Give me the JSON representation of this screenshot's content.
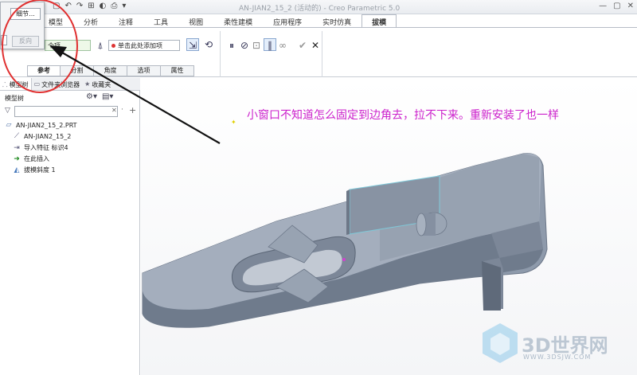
{
  "window": {
    "title": "AN-JIAN2_15_2 (活动的) - Creo Parametric 5.0",
    "quick_access": [
      "▢",
      "↶",
      "↷",
      "⊞",
      "◐",
      "⎙",
      "▾"
    ],
    "controls": [
      "—",
      "▢",
      "✕"
    ]
  },
  "ribbon": {
    "tabs": [
      "模型",
      "分析",
      "注释",
      "工具",
      "视图",
      "柔性建模",
      "应用程序",
      "实时仿真",
      "拔模"
    ],
    "active_tab": "拔模",
    "surface_field": "个项",
    "pivot_field_placeholder": "单击此处添加项",
    "subtabs": [
      "参考",
      "分割",
      "角度",
      "选项",
      "属性"
    ],
    "active_subtab": "参考",
    "control_icons": [
      "pause-icon",
      "stop-icon",
      "preview-icon",
      "verify-icon",
      "glasses-icon",
      "ok-icon",
      "cancel-icon"
    ]
  },
  "popup": {
    "detail_button": "细节...",
    "flip_button": "反向"
  },
  "panel": {
    "tabs": [
      "模型树",
      "文件夹浏览器",
      "收藏夹"
    ],
    "header": "模型树",
    "tree": [
      {
        "icon": "part-icon",
        "label": "AN-JIAN2_15_2.PRT",
        "indent": 0
      },
      {
        "icon": "feature-icon",
        "label": "AN-JIAN2_15_2",
        "indent": 1
      },
      {
        "icon": "import-icon",
        "label": "导入特征 标识4",
        "indent": 1
      },
      {
        "icon": "insert-here-icon",
        "label": "在此插入",
        "indent": 1
      },
      {
        "icon": "draft-icon",
        "label": "拔模斜度 1",
        "indent": 1
      }
    ]
  },
  "graphics": {
    "annotation": "小窗口不知道怎么固定到边角去，拉不下来。重新安装了也一样",
    "watermark": "3D世界网",
    "watermark_url": "WWW.3DSJW.COM"
  },
  "colors": {
    "annotation": "#cc22cc",
    "highlight_circle": "#e03030",
    "model_face": "#8e9aab"
  }
}
